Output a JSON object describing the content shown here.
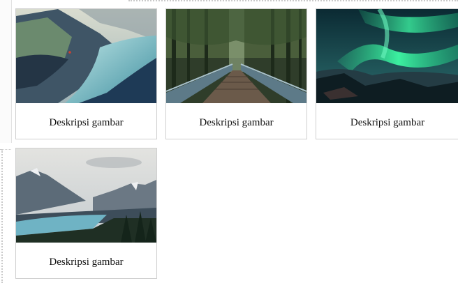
{
  "gallery": {
    "items": [
      {
        "description": "Deskripsi gambar",
        "image": "mountain-lake-fjord-photo"
      },
      {
        "description": "Deskripsi gambar",
        "image": "forest-bridge-photo"
      },
      {
        "description": "Deskripsi gambar",
        "image": "aurora-borealis-photo"
      },
      {
        "description": "Deskripsi gambar",
        "image": "mountain-lake-valley-photo"
      }
    ]
  }
}
